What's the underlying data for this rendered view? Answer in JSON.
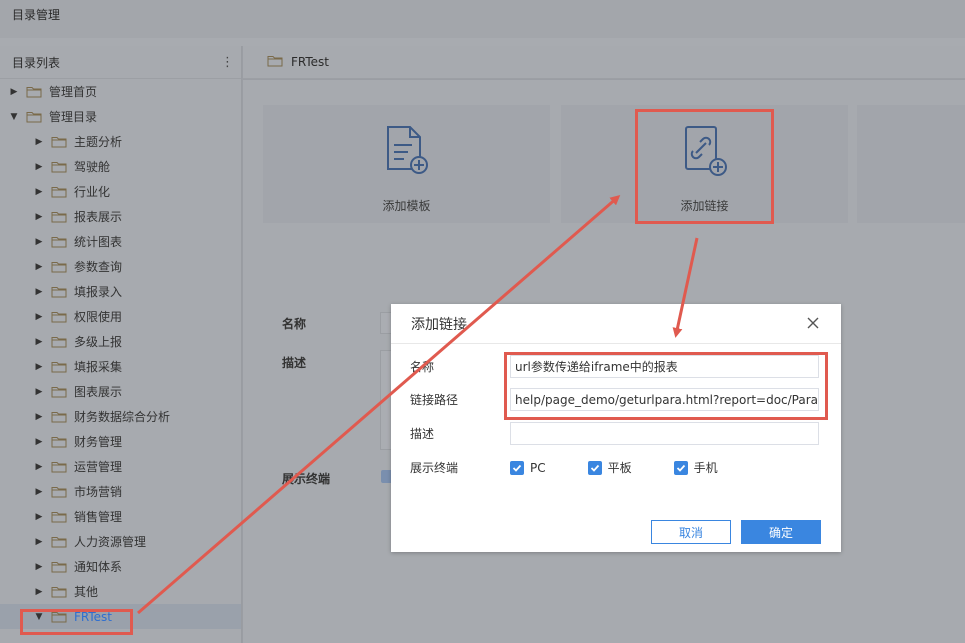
{
  "app": {
    "title": "目录管理"
  },
  "sidebar": {
    "title": "目录列表",
    "items": [
      {
        "label": "管理首页",
        "level": 0,
        "expanded": false
      },
      {
        "label": "管理目录",
        "level": 0,
        "expanded": true
      },
      {
        "label": "主题分析",
        "level": 1
      },
      {
        "label": "驾驶舱",
        "level": 1
      },
      {
        "label": "行业化",
        "level": 1
      },
      {
        "label": "报表展示",
        "level": 1
      },
      {
        "label": "统计图表",
        "level": 1
      },
      {
        "label": "参数查询",
        "level": 1
      },
      {
        "label": "填报录入",
        "level": 1
      },
      {
        "label": "权限使用",
        "level": 1
      },
      {
        "label": "多级上报",
        "level": 1
      },
      {
        "label": "填报采集",
        "level": 1
      },
      {
        "label": "图表展示",
        "level": 1
      },
      {
        "label": "财务数据综合分析",
        "level": 1
      },
      {
        "label": "财务管理",
        "level": 1
      },
      {
        "label": "运营管理",
        "level": 1
      },
      {
        "label": "市场营销",
        "level": 1
      },
      {
        "label": "销售管理",
        "level": 1
      },
      {
        "label": "人力资源管理",
        "level": 1
      },
      {
        "label": "通知体系",
        "level": 1
      },
      {
        "label": "其他",
        "level": 1
      },
      {
        "label": "FRTest",
        "level": 1,
        "expanded": true,
        "selected": true
      }
    ]
  },
  "main": {
    "breadcrumb": "FRTest",
    "cards": [
      {
        "label": "添加模板"
      },
      {
        "label": "添加链接"
      }
    ],
    "form": {
      "name_label": "名称",
      "desc_label": "描述",
      "terminal_label": "展示终端"
    }
  },
  "dialog": {
    "title": "添加链接",
    "name_label": "名称",
    "name_value": "url参数传递给iframe中的报表",
    "path_label": "链接路径",
    "path_value": "help/page_demo/geturlpara.html?report=doc/Parame",
    "desc_label": "描述",
    "desc_value": "",
    "terminal_label": "展示终端",
    "terminals": [
      {
        "label": "PC",
        "checked": true
      },
      {
        "label": "平板",
        "checked": true
      },
      {
        "label": "手机",
        "checked": true
      }
    ],
    "cancel_label": "取消",
    "ok_label": "确定"
  },
  "colors": {
    "accent": "#3a86e0",
    "annotation": "#e05a4f",
    "selected_text": "#2f6fcf"
  }
}
